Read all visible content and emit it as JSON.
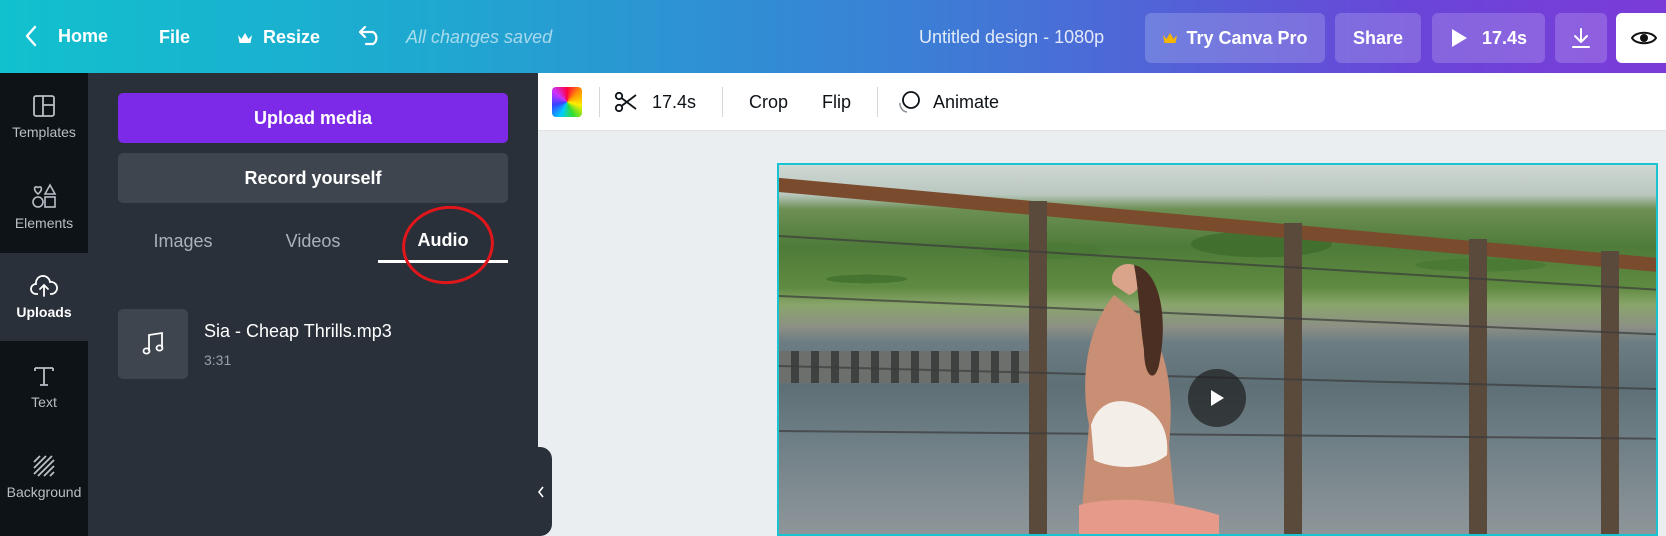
{
  "topbar": {
    "home_label": "Home",
    "file_label": "File",
    "resize_label": "Resize",
    "save_status": "All changes saved",
    "doc_title": "Untitled design - 1080p",
    "try_pro_label": "Try Canva Pro",
    "share_label": "Share",
    "play_duration": "17.4s"
  },
  "rail": {
    "items": [
      {
        "label": "Templates",
        "icon": "templates-icon"
      },
      {
        "label": "Elements",
        "icon": "elements-icon"
      },
      {
        "label": "Uploads",
        "icon": "uploads-icon",
        "active": true
      },
      {
        "label": "Text",
        "icon": "text-icon"
      },
      {
        "label": "Background",
        "icon": "background-icon"
      }
    ]
  },
  "panel": {
    "upload_label": "Upload media",
    "record_label": "Record yourself",
    "tabs": [
      {
        "label": "Images"
      },
      {
        "label": "Videos"
      },
      {
        "label": "Audio",
        "active": true
      }
    ],
    "audio_items": [
      {
        "name": "Sia - Cheap Thrills.mp3",
        "duration": "3:31"
      }
    ]
  },
  "toolbar": {
    "trim_duration": "17.4s",
    "crop_label": "Crop",
    "flip_label": "Flip",
    "animate_label": "Animate"
  },
  "colors": {
    "accent_purple": "#7d2ae8",
    "panel_bg": "#293039",
    "rail_bg": "#0e1318",
    "selection_border": "#18c4d2",
    "annotation_red": "#e0161b"
  }
}
